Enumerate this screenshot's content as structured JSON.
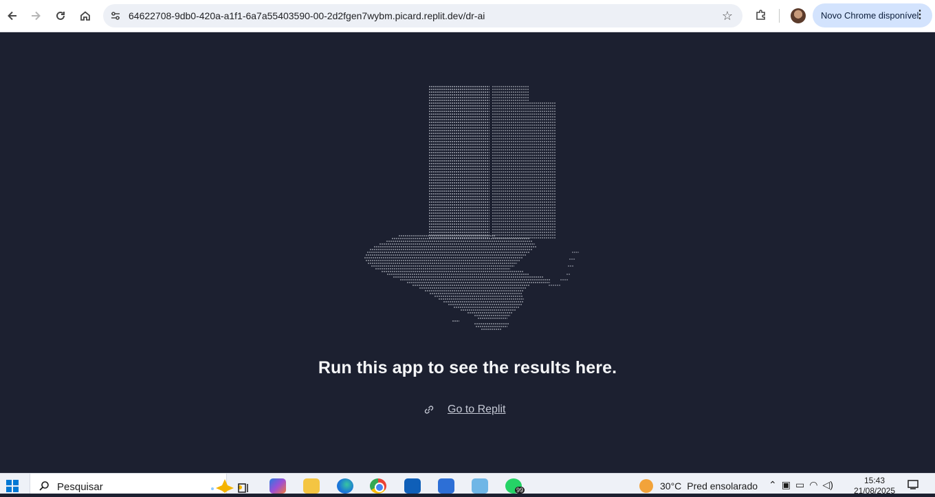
{
  "browser": {
    "url": "64622708-9db0-420a-a1f1-6a7a55403590-00-2d2fgen7wybm.picard.replit.dev/dr-ai",
    "update_label": "Novo Chrome disponível"
  },
  "page": {
    "message": "Run this app to see the results here.",
    "link_label": "Go to Replit"
  },
  "taskbar": {
    "search_placeholder": "Pesquisar",
    "whatsapp_badge": "99",
    "weather_temp": "30°C",
    "weather_desc": "Pred ensolarado",
    "time": "15:43",
    "date": "21/08/2025"
  },
  "colors": {
    "page_bg": "#1c2030",
    "art": "#b8bcc6",
    "chip": "#d3e3fd"
  }
}
